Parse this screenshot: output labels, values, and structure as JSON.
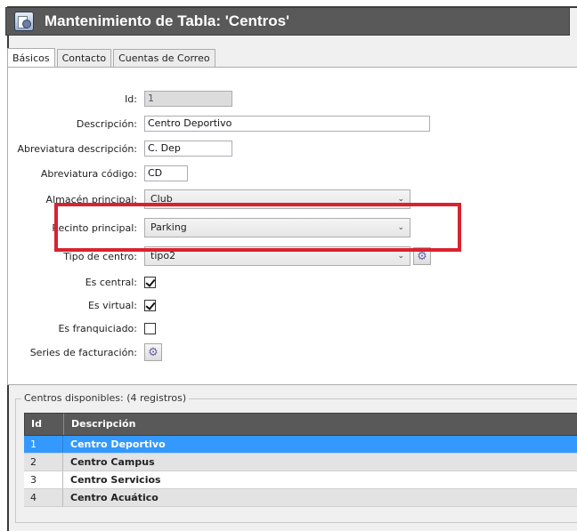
{
  "window": {
    "title": "Mantenimiento de Tabla: 'Centros'",
    "icon": "table-settings-icon"
  },
  "tabs": [
    {
      "label": "Básicos",
      "active": true
    },
    {
      "label": "Contacto",
      "active": false
    },
    {
      "label": "Cuentas de Correo",
      "active": false
    }
  ],
  "form": {
    "id": {
      "label": "Id:",
      "value": "1"
    },
    "descripcion": {
      "label": "Descripción:",
      "value": "Centro Deportivo"
    },
    "abrev_desc": {
      "label": "Abreviatura descripción:",
      "value": "C. Dep"
    },
    "abrev_codigo": {
      "label": "Abreviatura código:",
      "value": "CD"
    },
    "almacen": {
      "label": "Almacén principal:",
      "value": "Club"
    },
    "recinto": {
      "label": "Recinto principal:",
      "value": "Parking"
    },
    "tipo_centro": {
      "label": "Tipo de centro:",
      "value": "tipo2"
    },
    "es_central": {
      "label": "Es central:",
      "checked": true
    },
    "es_virtual": {
      "label": "Es virtual:",
      "checked": true
    },
    "es_franquiciado": {
      "label": "Es franquiciado:",
      "checked": false
    },
    "series": {
      "label": "Series de facturación:"
    }
  },
  "grid": {
    "legend": "Centros disponibles:  (4 registros)",
    "columns": [
      "Id",
      "Descripción"
    ],
    "rows": [
      {
        "id": "1",
        "descripcion": "Centro Deportivo",
        "selected": true
      },
      {
        "id": "2",
        "descripcion": "Centro Campus",
        "selected": false
      },
      {
        "id": "3",
        "descripcion": "Centro Servicios",
        "selected": false
      },
      {
        "id": "4",
        "descripcion": "Centro Acuático",
        "selected": false
      }
    ]
  },
  "colors": {
    "titlebar": "#595959",
    "highlight": "#d8232f",
    "selection": "#3399ff"
  }
}
